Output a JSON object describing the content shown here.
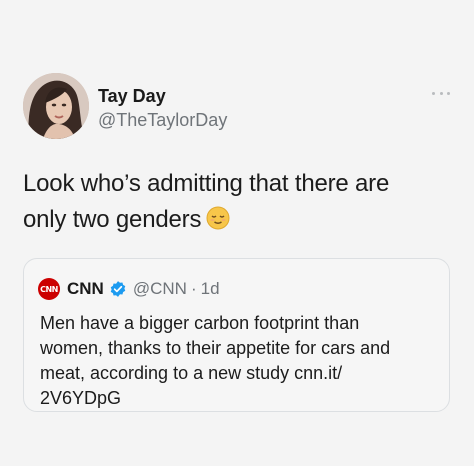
{
  "author": {
    "name": "Tay Day",
    "handle": "@TheTaylorDay",
    "avatar_icon": "profile-photo"
  },
  "tweet": {
    "text_lines": [
      "Look who’s admitting that there are",
      "only two genders"
    ],
    "emoji": "relieved-face"
  },
  "quoted_tweet": {
    "avatar_text": "CNN",
    "name": "CNN",
    "verified_icon": "verified-badge-icon",
    "handle": "@CNN",
    "separator": "·",
    "time": "1d",
    "text_lines": [
      "Men have a bigger carbon footprint than",
      "women, thanks to their appetite for cars and",
      "meat, according to a new study cnn.it/",
      "2V6YDpG"
    ]
  },
  "colors": {
    "background": "#f4f4f4",
    "secondary_text": "#6f7479",
    "verified_blue": "#1d9bf0",
    "cnn_red": "#cc0000",
    "card_border": "#dcdfe2"
  }
}
